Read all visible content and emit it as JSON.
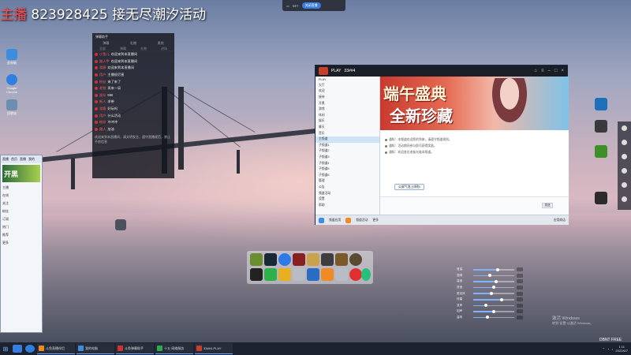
{
  "overlay": {
    "prefix": "主播",
    "text": "823928425 接无尽潮汐活动"
  },
  "desktop_icons": [
    {
      "label": "此电脑",
      "color": "#3c8dde"
    },
    {
      "label": "Google Chrome",
      "color": "#2f7fe0"
    },
    {
      "label": "回收站",
      "color": "#6c8cb0"
    }
  ],
  "chat_panel": {
    "title": "弹幕助手",
    "tabs": [
      "弹幕",
      "礼物",
      "贵宾"
    ],
    "subtabs": [
      "全部",
      "弹幕",
      "礼物",
      "进场"
    ],
    "lines": [
      {
        "nick": "小鱼儿",
        "msg": "欢迎来到本直播间"
      },
      {
        "nick": "路人甲",
        "msg": "欢迎来到本直播间"
      },
      {
        "nick": "游客",
        "msg": "欢迎来到本直播间"
      },
      {
        "nick": "用户",
        "msg": "主播很厉害"
      },
      {
        "nick": "粉丝",
        "msg": "来了来了"
      },
      {
        "nick": "老铁",
        "msg": "再来一局"
      },
      {
        "nick": "观众",
        "msg": "666"
      },
      {
        "nick": "新人",
        "msg": "求带"
      },
      {
        "nick": "游客",
        "msg": "好玩吗"
      },
      {
        "nick": "用户",
        "msg": "什么活动"
      },
      {
        "nick": "粉丝",
        "msg": "冲冲冲"
      },
      {
        "nick": "路人",
        "msg": "加油"
      }
    ],
    "footer": "欢迎来到本直播间，请文明发言，遵守直播规范，禁止不良信息"
  },
  "left_window": {
    "title": "直播",
    "tabs": [
      "首页",
      "直播",
      "我的"
    ],
    "banner": "开黑",
    "rows": [
      "主播",
      "在线",
      "关注",
      "粉丝",
      "订阅",
      "热门",
      "推荐",
      "更多"
    ]
  },
  "yy": {
    "brand": "PLAY",
    "channel_id": "33##4",
    "channel_items": [
      "PLAY",
      "大厅",
      "欢迎",
      "接待",
      "开黑",
      "游戏",
      "休闲",
      "娱乐",
      "聊天",
      "音乐",
      "主频道",
      "子频道1",
      "子频道2",
      "子频道3",
      "子频道4",
      "子频道5",
      "子频道6",
      "管理",
      "公告",
      "频道活动",
      "设置",
      "帮助"
    ],
    "banner_line1": "端午盛典",
    "banner_line2": "全新珍藏",
    "messages": [
      "通知：本频道欢迎您的到来，请遵守频道规则。",
      "通知：活动期间参与即可获得奖励。",
      "通知：欢迎各位老板光临本频道。"
    ],
    "up_button": "公屏气泡上线啦!",
    "input_placeholder": "",
    "send_label": "发送",
    "footer_items": [
      "频道应用",
      "频道活动",
      "更多"
    ],
    "footer_right": "应用商店"
  },
  "top_bar": {
    "label": "SET",
    "button": "关闭直播"
  },
  "mixer": {
    "rows": [
      {
        "label": "音量",
        "value": 0.6
      },
      {
        "label": "混响",
        "value": 0.4
      },
      {
        "label": "高音",
        "value": 0.55
      },
      {
        "label": "低音",
        "value": 0.5
      },
      {
        "label": "麦克风",
        "value": 0.45
      },
      {
        "label": "伴奏",
        "value": 0.7
      },
      {
        "label": "变声",
        "value": 0.3
      },
      {
        "label": "回声",
        "value": 0.5
      },
      {
        "label": "监听",
        "value": 0.35
      }
    ]
  },
  "activate": {
    "line1": "激活 Windows",
    "line2": "转到\"设置\"以激活 Windows。"
  },
  "watermark": "DBNT FREE",
  "taskbar": {
    "tasks": [
      {
        "label": "斗鱼直播伴侣",
        "color": "#f08a24"
      },
      {
        "label": "我的电脑",
        "color": "#3c8dde"
      },
      {
        "label": "斗鱼弹幕助手",
        "color": "#c33"
      },
      {
        "label": "十五·网络服务",
        "color": "#2fa84f"
      },
      {
        "label": "33##4-PLAY",
        "color": "#c8402c"
      }
    ],
    "time": "1:11",
    "date": "2022/6/7"
  }
}
